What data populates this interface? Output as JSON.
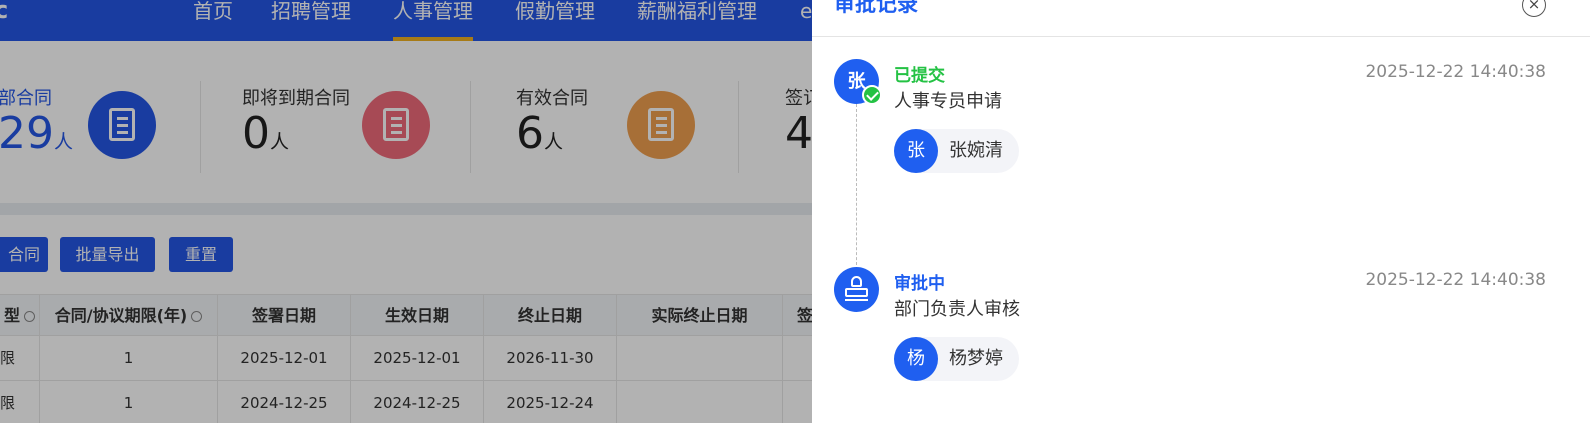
{
  "app": {
    "logo_fragment": "c"
  },
  "nav": {
    "items": [
      {
        "label": "首页"
      },
      {
        "label": "招聘管理"
      },
      {
        "label": "人事管理"
      },
      {
        "label": "假勤管理"
      },
      {
        "label": "薪酬福利管理"
      },
      {
        "label": "e"
      }
    ],
    "active_index": 2,
    "active_underline_color": "#f0b020"
  },
  "stats": [
    {
      "label": "部合同",
      "value": "29",
      "unit": "人",
      "icon": "document-icon",
      "color": "#2456e6"
    },
    {
      "label": "即将到期合同",
      "value": "0",
      "unit": "人",
      "icon": "document-icon",
      "color": "#f06a7a"
    },
    {
      "label": "有效合同",
      "value": "6",
      "unit": "人",
      "icon": "document-icon",
      "color": "#f0a050"
    },
    {
      "label": "签订",
      "value": "4",
      "unit": "",
      "icon": "document-icon",
      "color": "#2456e6"
    }
  ],
  "actions": {
    "add_label": "合同",
    "export_label": "批量导出",
    "reset_label": "重置"
  },
  "table": {
    "headers": [
      "型",
      "合同/协议期限(年)",
      "签署日期",
      "生效日期",
      "终止日期",
      "实际终止日期",
      "签"
    ],
    "rows": [
      [
        "限",
        "1",
        "2025-12-01",
        "2025-12-01",
        "2026-11-30",
        "",
        ""
      ],
      [
        "限",
        "1",
        "2024-12-25",
        "2024-12-25",
        "2025-12-24",
        "",
        ""
      ]
    ]
  },
  "drawer": {
    "title": "审批记录",
    "close_icon": "close-icon",
    "steps": [
      {
        "node_char": "张",
        "status": "已提交",
        "status_color": "#24c244",
        "description": "人事专员申请",
        "time": "2025-12-22 14:40:38",
        "person": {
          "avatar_char": "张",
          "name": "张婉清"
        }
      },
      {
        "node_icon": "stamp-icon",
        "status": "审批中",
        "status_color": "#1f5ff0",
        "description": "部门负责人审核",
        "time": "2025-12-22 14:40:38",
        "person": {
          "avatar_char": "杨",
          "name": "杨梦婷"
        }
      }
    ]
  }
}
